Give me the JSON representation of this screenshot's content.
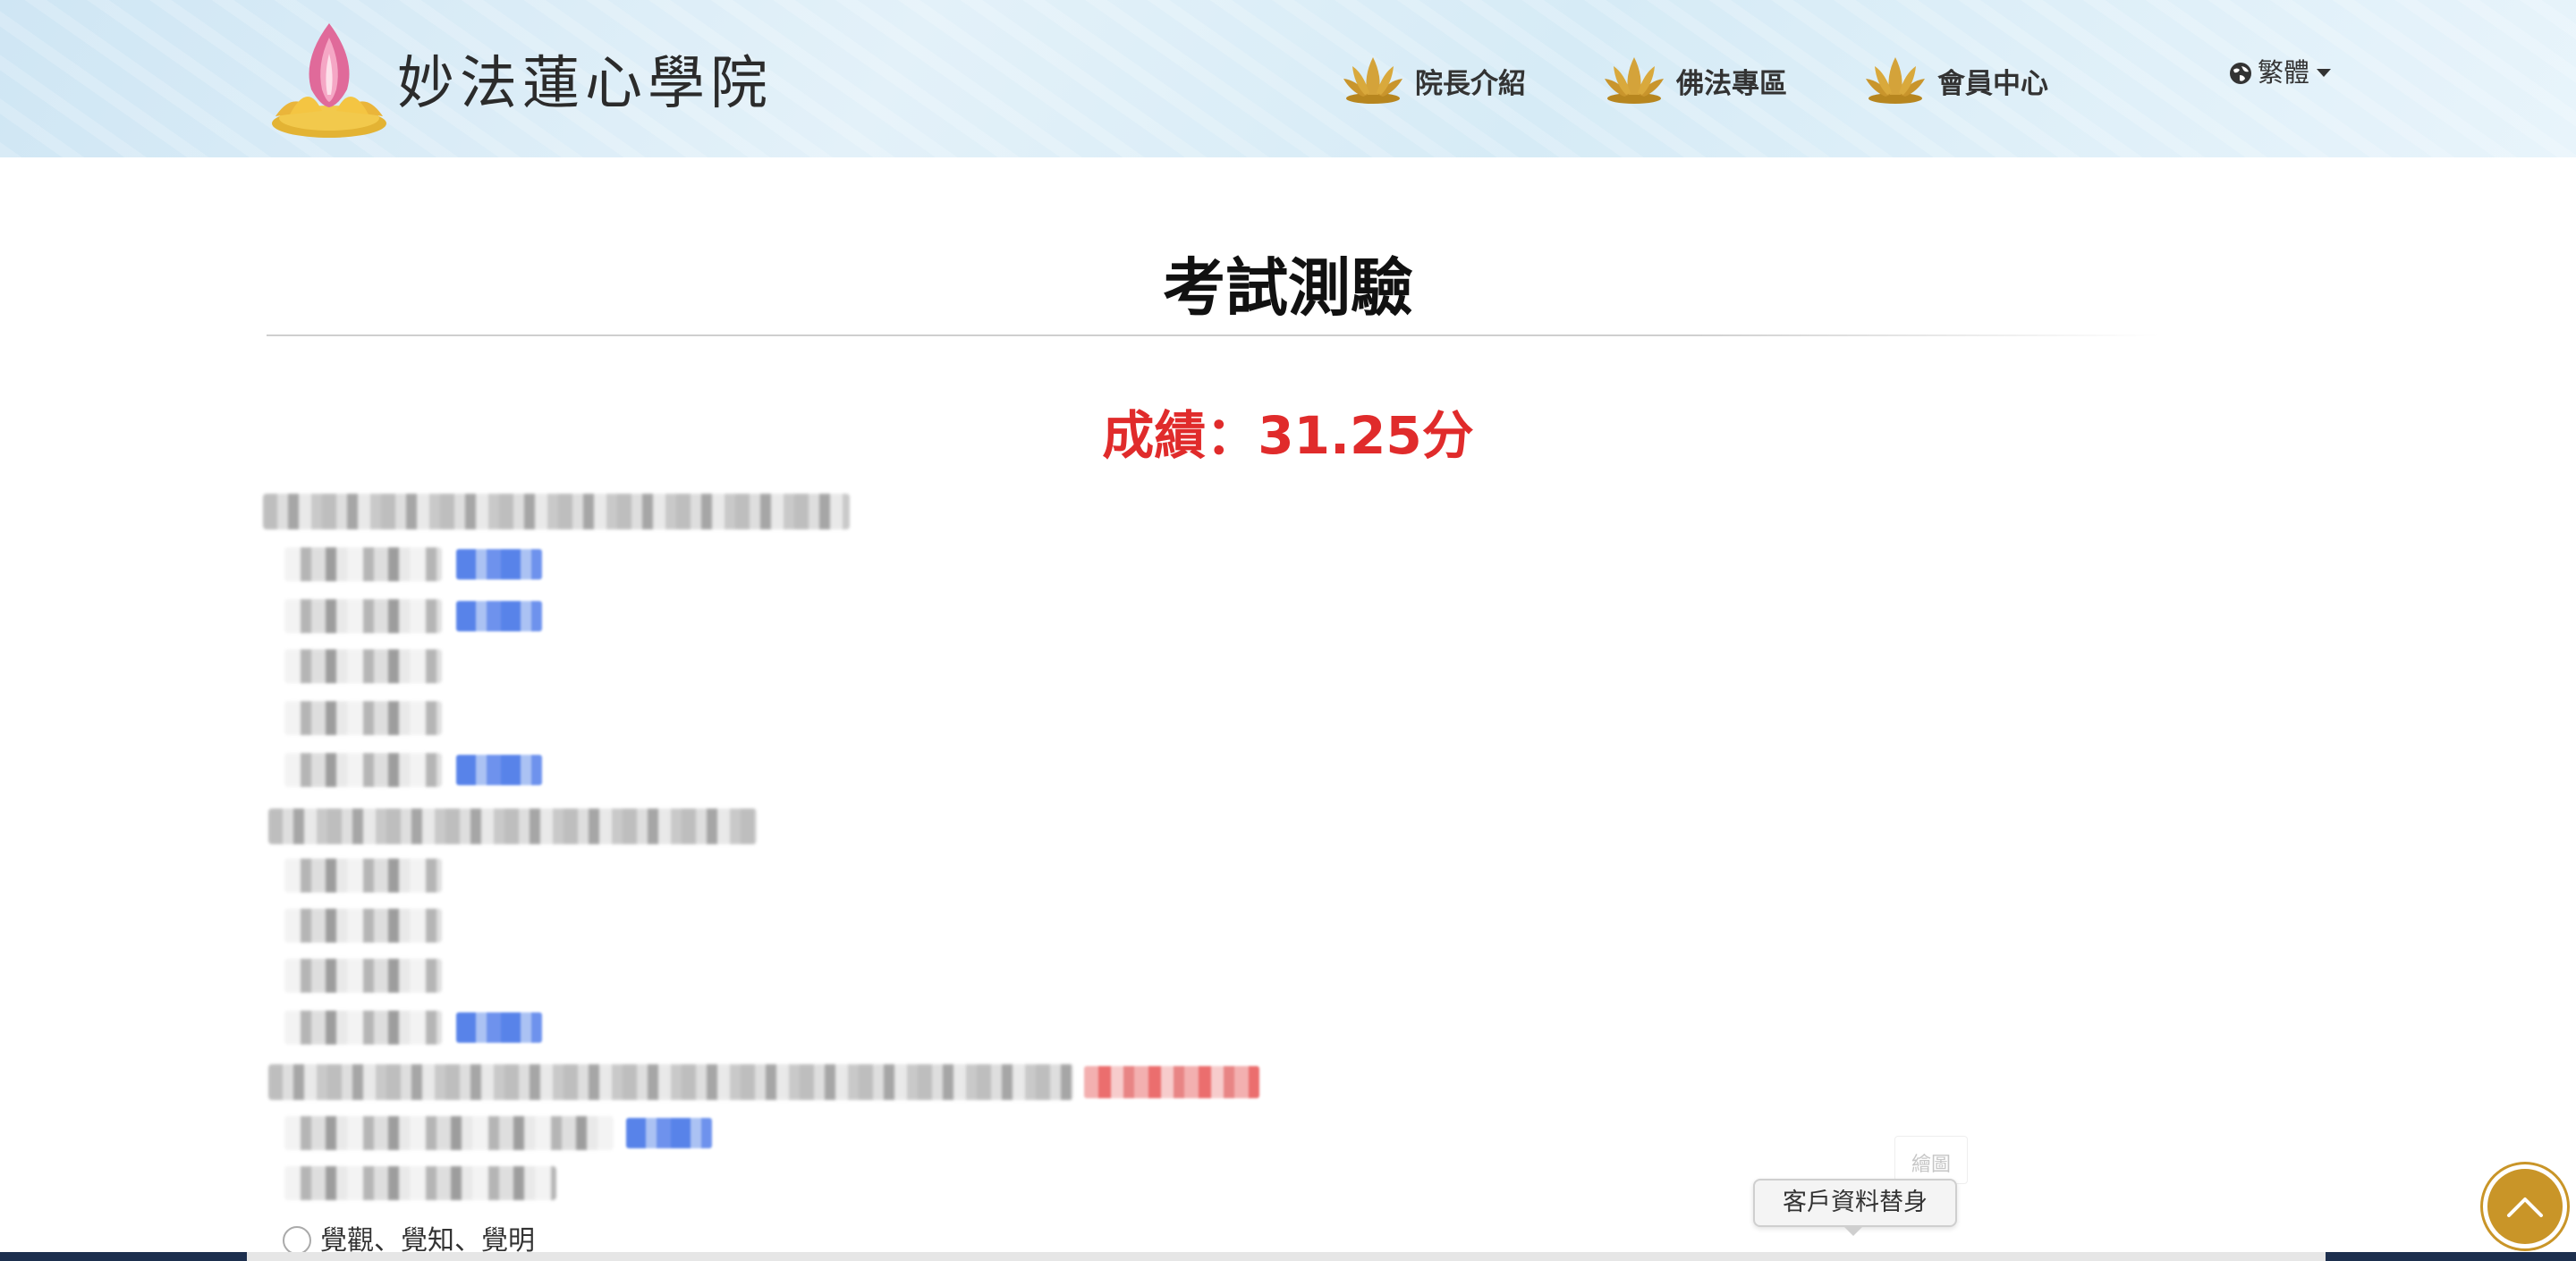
{
  "header": {
    "site_title": "妙法蓮心學院",
    "nav": [
      {
        "label": "院長介紹",
        "icon": "lotus-icon"
      },
      {
        "label": "佛法專區",
        "icon": "lotus-icon"
      },
      {
        "label": "會員中心",
        "icon": "lotus-icon"
      }
    ],
    "language": {
      "label": "繁體",
      "icon": "globe-icon"
    }
  },
  "main": {
    "title": "考試測驗",
    "score": "成績：31.25分",
    "visible_option": "覺觀、覺知、覺明"
  },
  "floating": {
    "hint": "繪圖",
    "tooltip": "客戶資料替身"
  },
  "colors": {
    "accent_gold": "#c99528",
    "score_red": "#e02b2b",
    "link_blue": "#3b6ee6"
  }
}
